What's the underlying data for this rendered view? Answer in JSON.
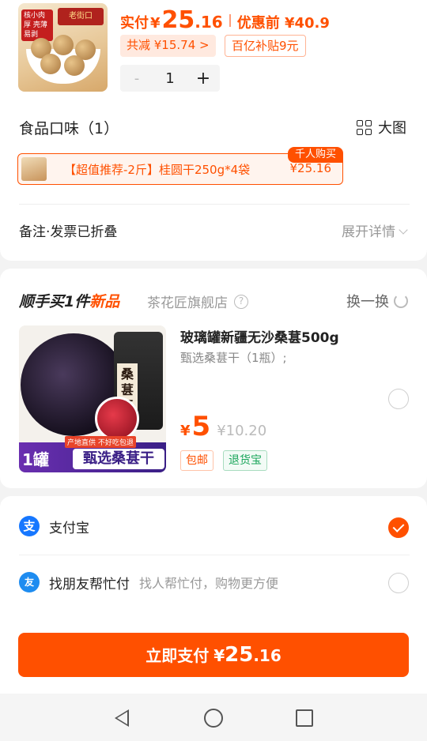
{
  "order": {
    "thumb_badge": "核小肉厚 壳薄易剥",
    "thumb_brand": "老街口",
    "price_label": "实付",
    "currency": "¥",
    "price_int": "25",
    "price_dec": ".16",
    "pre_discount": "优惠前 ¥40.9",
    "reduce_tag": "共减 ¥15.74 >",
    "subsidy_tag": "百亿补贴9元",
    "qty_minus": "-",
    "qty": "1",
    "qty_plus": "+"
  },
  "flavor": {
    "title": "食品口味（1）",
    "bigview_label": "大图",
    "option_text": "【超值推荐-2斤】桂圆干250g*4袋",
    "option_price": "¥25.16",
    "hot_tag": "千人购买"
  },
  "remark": {
    "label": "备注·发票已折叠",
    "expand": "展开详情"
  },
  "upsell": {
    "title_prefix": "顺手买1件",
    "title_new": "新品",
    "shop": "茶花匠旗舰店",
    "help": "?",
    "swap": "换一换",
    "product_name": "玻璃罐新疆无沙桑葚500g",
    "product_spec": "甄选桑葚干（1瓶）;",
    "currency": "¥",
    "price": "5",
    "orig_price": "¥10.20",
    "tag_ship": "包邮",
    "tag_return": "退货宝",
    "img_jar_label": "桑葚干",
    "img_badge": "产地直供  不好吃包退",
    "img_banner_count": "1罐",
    "img_banner_text": "甄选桑葚干",
    "selected": false
  },
  "payment": {
    "methods": [
      {
        "name": "支付宝",
        "icon": "alipay-icon",
        "icon_glyph": "支",
        "hint": "",
        "selected": true
      },
      {
        "name": "找朋友帮忙付",
        "icon": "friend-pay-icon",
        "icon_glyph": "友",
        "hint": "找人帮忙付，购物更方便",
        "selected": false
      }
    ],
    "button_label": "立即支付",
    "button_currency": "¥",
    "button_int": "25",
    "button_dec": ".16"
  },
  "colors": {
    "accent": "#ff5000",
    "green": "#19a55a",
    "alipay_blue": "#1677ff"
  }
}
